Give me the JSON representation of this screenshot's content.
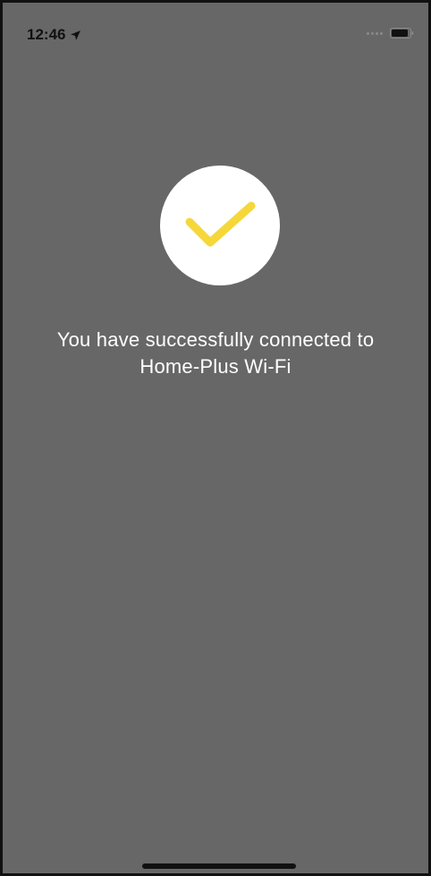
{
  "status_bar": {
    "time": "12:46",
    "location_icon": "location-arrow-icon",
    "signal_icon": "signal-dots-icon",
    "battery_icon": "battery-icon"
  },
  "success": {
    "icon": "checkmark-icon",
    "circle_color": "#ffffff",
    "check_color": "#f6d73a"
  },
  "message": {
    "line1": "You have successfully connected to",
    "line2": "Home-Plus Wi-Fi"
  },
  "colors": {
    "background": "#676767",
    "text": "#ffffff"
  }
}
